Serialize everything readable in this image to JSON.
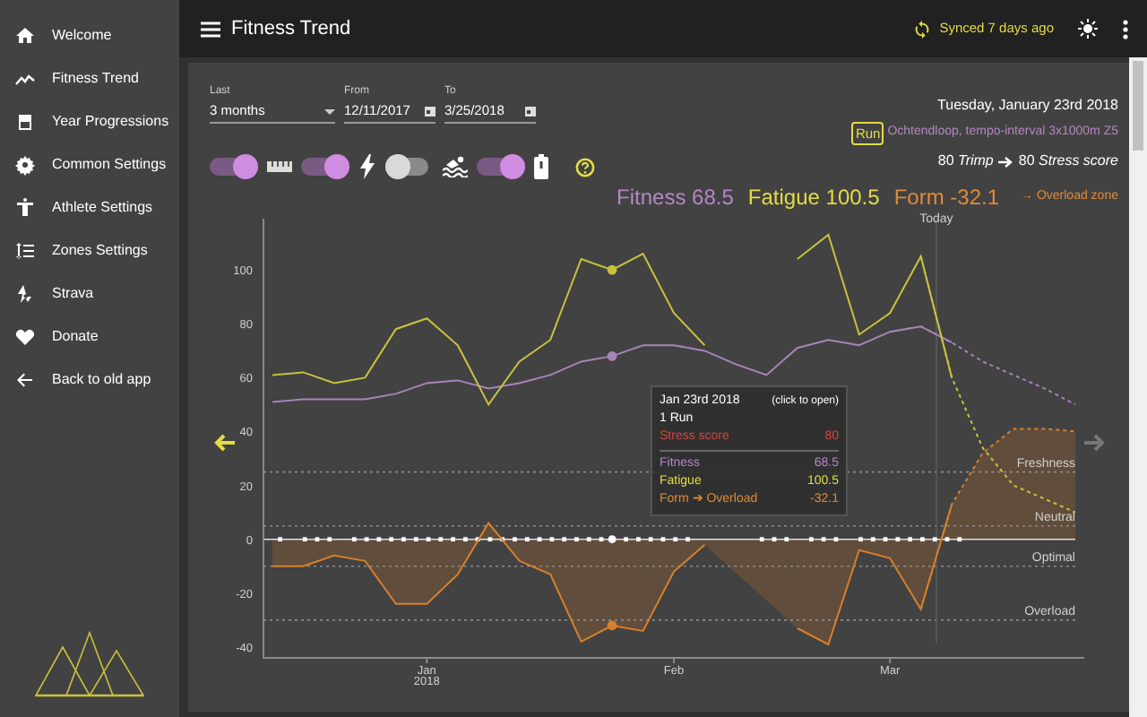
{
  "sidebar": {
    "items": [
      {
        "label": "Welcome"
      },
      {
        "label": "Fitness Trend"
      },
      {
        "label": "Year Progressions"
      },
      {
        "label": "Common Settings"
      },
      {
        "label": "Athlete Settings"
      },
      {
        "label": "Zones Settings"
      },
      {
        "label": "Strava"
      },
      {
        "label": "Donate"
      },
      {
        "label": "Back to old app"
      }
    ]
  },
  "header": {
    "title": "Fitness Trend",
    "sync_status": "Synced 7 days ago"
  },
  "filters": [
    {
      "label": "Last",
      "value": "3 months",
      "kind": "select"
    },
    {
      "label": "From",
      "value": "12/11/2017",
      "kind": "date"
    },
    {
      "label": "To",
      "value": "3/25/2018",
      "kind": "date"
    }
  ],
  "toggles": [
    {
      "on": true
    },
    {
      "on": true
    },
    {
      "on": false
    },
    {
      "on": true
    }
  ],
  "day": {
    "date": "Tuesday, January 23rd 2018",
    "activity_type": "Run",
    "activity_name": "Ochtendloop, tempo-interval 3x1000m Z5",
    "trimp": "80",
    "trimp_label": "Trimp",
    "stress": "80",
    "stress_label": "Stress score"
  },
  "metrics": [
    {
      "value": "68.5",
      "color": "#b487c4"
    },
    {
      "value": "100.5",
      "color": "#e3dc45"
    },
    {
      "value": "-32.1",
      "color": "#e08a36"
    }
  ],
  "zone": "→ Overload zone",
  "chart": {
    "chart_data": {
      "type": "line",
      "categories": [
        null,
        null,
        null,
        null,
        null,
        "Jan\n2018",
        null,
        null,
        null,
        null,
        null,
        null,
        null,
        "Feb",
        null,
        null,
        null,
        null,
        null,
        null,
        "Mar",
        null,
        null,
        null,
        null,
        null,
        null
      ],
      "series": [
        {
          "name": "Fitness",
          "color": "#a884b8",
          "values": [
            51,
            52,
            52,
            52,
            54,
            58,
            59,
            56,
            58,
            61,
            66,
            68,
            72,
            72,
            70,
            65,
            61,
            71,
            74,
            72,
            77,
            79,
            73,
            66,
            61,
            56,
            50
          ]
        },
        {
          "name": "Fatigue",
          "color": "#c9c23c",
          "values": [
            61,
            62,
            58,
            60,
            78,
            82,
            72,
            50,
            66,
            74,
            104,
            100,
            106,
            84,
            72,
            null,
            null,
            104,
            113,
            76,
            84,
            105,
            60,
            34,
            20,
            15,
            10
          ]
        },
        {
          "name": "Form",
          "color": "#d6802e",
          "values": [
            -10,
            -10,
            -6,
            -8,
            -24,
            -24,
            -13,
            6,
            -8,
            -13,
            -38,
            -32,
            -34,
            -12,
            -2,
            null,
            null,
            -33,
            -39,
            -4,
            -7,
            -26,
            13,
            32,
            41,
            41,
            40
          ]
        }
      ],
      "ylim": [
        -44,
        119
      ],
      "yticks": [
        -40,
        -20,
        0,
        20,
        40,
        60,
        80,
        100
      ],
      "annotations": [
        "Today"
      ],
      "ref_lines": [
        {
          "label": "Freshness"
        },
        {
          "label": "Neutral"
        },
        {
          "label": "Optimal"
        },
        {
          "label": "Overload"
        }
      ]
    },
    "tooltip": {
      "date": "Jan 23rd 2018",
      "hint": "(click to open)",
      "count": "1 Run",
      "rows": [
        {
          "label": "Stress score",
          "value": "80",
          "color": "#d0463c",
          "divider": false
        },
        {
          "label": "Fitness",
          "value": "68.5",
          "color": "#b487c4",
          "divider": true
        },
        {
          "label": "Fatigue",
          "value": "100.5",
          "color": "#e3dc45",
          "divider": false
        },
        {
          "label": "Form ➔ Overload",
          "value": "-32.1",
          "color": "#e08a36",
          "divider": false
        }
      ]
    }
  }
}
